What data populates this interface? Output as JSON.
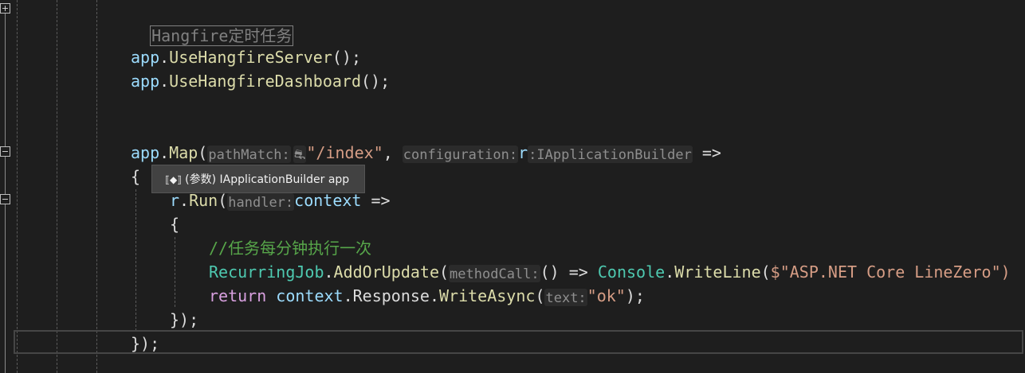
{
  "editor": {
    "region_label": "Hangfire定时任务",
    "line1": {
      "obj": "app",
      "dot": ".",
      "method": "UseHangfireServer",
      "tail": "();"
    },
    "line2": {
      "obj": "app",
      "dot": ".",
      "method": "UseHangfireDashboard",
      "tail": "();"
    },
    "map": {
      "obj": "app",
      "dot": ".",
      "method": "Map",
      "open": "(",
      "hint_path": "pathMatch:",
      "hint_icon": "⛐",
      "path_string": "\"/index\"",
      "comma": ", ",
      "hint_config": "configuration:",
      "param": "r",
      "hint_type": ":IApplicationBuilder",
      "arrow": " =>"
    },
    "brace_open": "{",
    "run": {
      "obj": "r",
      "dot": ".",
      "method": "Run",
      "open": "(",
      "hint_handler": "handler:",
      "param": "context",
      "arrow": " =>"
    },
    "inner_brace_open": "{",
    "comment": "//任务每分钟执行一次",
    "recurring": {
      "cls": "RecurringJob",
      "dot": ".",
      "method": "AddOrUpdate",
      "open": "(",
      "hint": "methodCall:",
      "lambda": "() => ",
      "cls2": "Console",
      "dot2": ".",
      "method2": "WriteLine",
      "open2": "(",
      "string": "$\"ASP.NET Core LineZero\")"
    },
    "return_line": {
      "kw": "return",
      "obj": "context",
      "dot": ".",
      "prop": "Response",
      "dot2": ".",
      "method": "WriteAsync",
      "open": "(",
      "hint": "text:",
      "string": "\"ok\"",
      "close": ");"
    },
    "inner_brace_close": "});",
    "brace_close": "});"
  },
  "tooltip": {
    "icon": "param-icon",
    "text": "(参数) IApplicationBuilder app"
  },
  "colors": {
    "background": "#1e1e1e",
    "variable": "#9cdcfe",
    "method": "#dcdcaa",
    "string": "#d69d85",
    "keyword": "#d8a0df",
    "class": "#4ec9b0",
    "comment": "#57a64a"
  }
}
